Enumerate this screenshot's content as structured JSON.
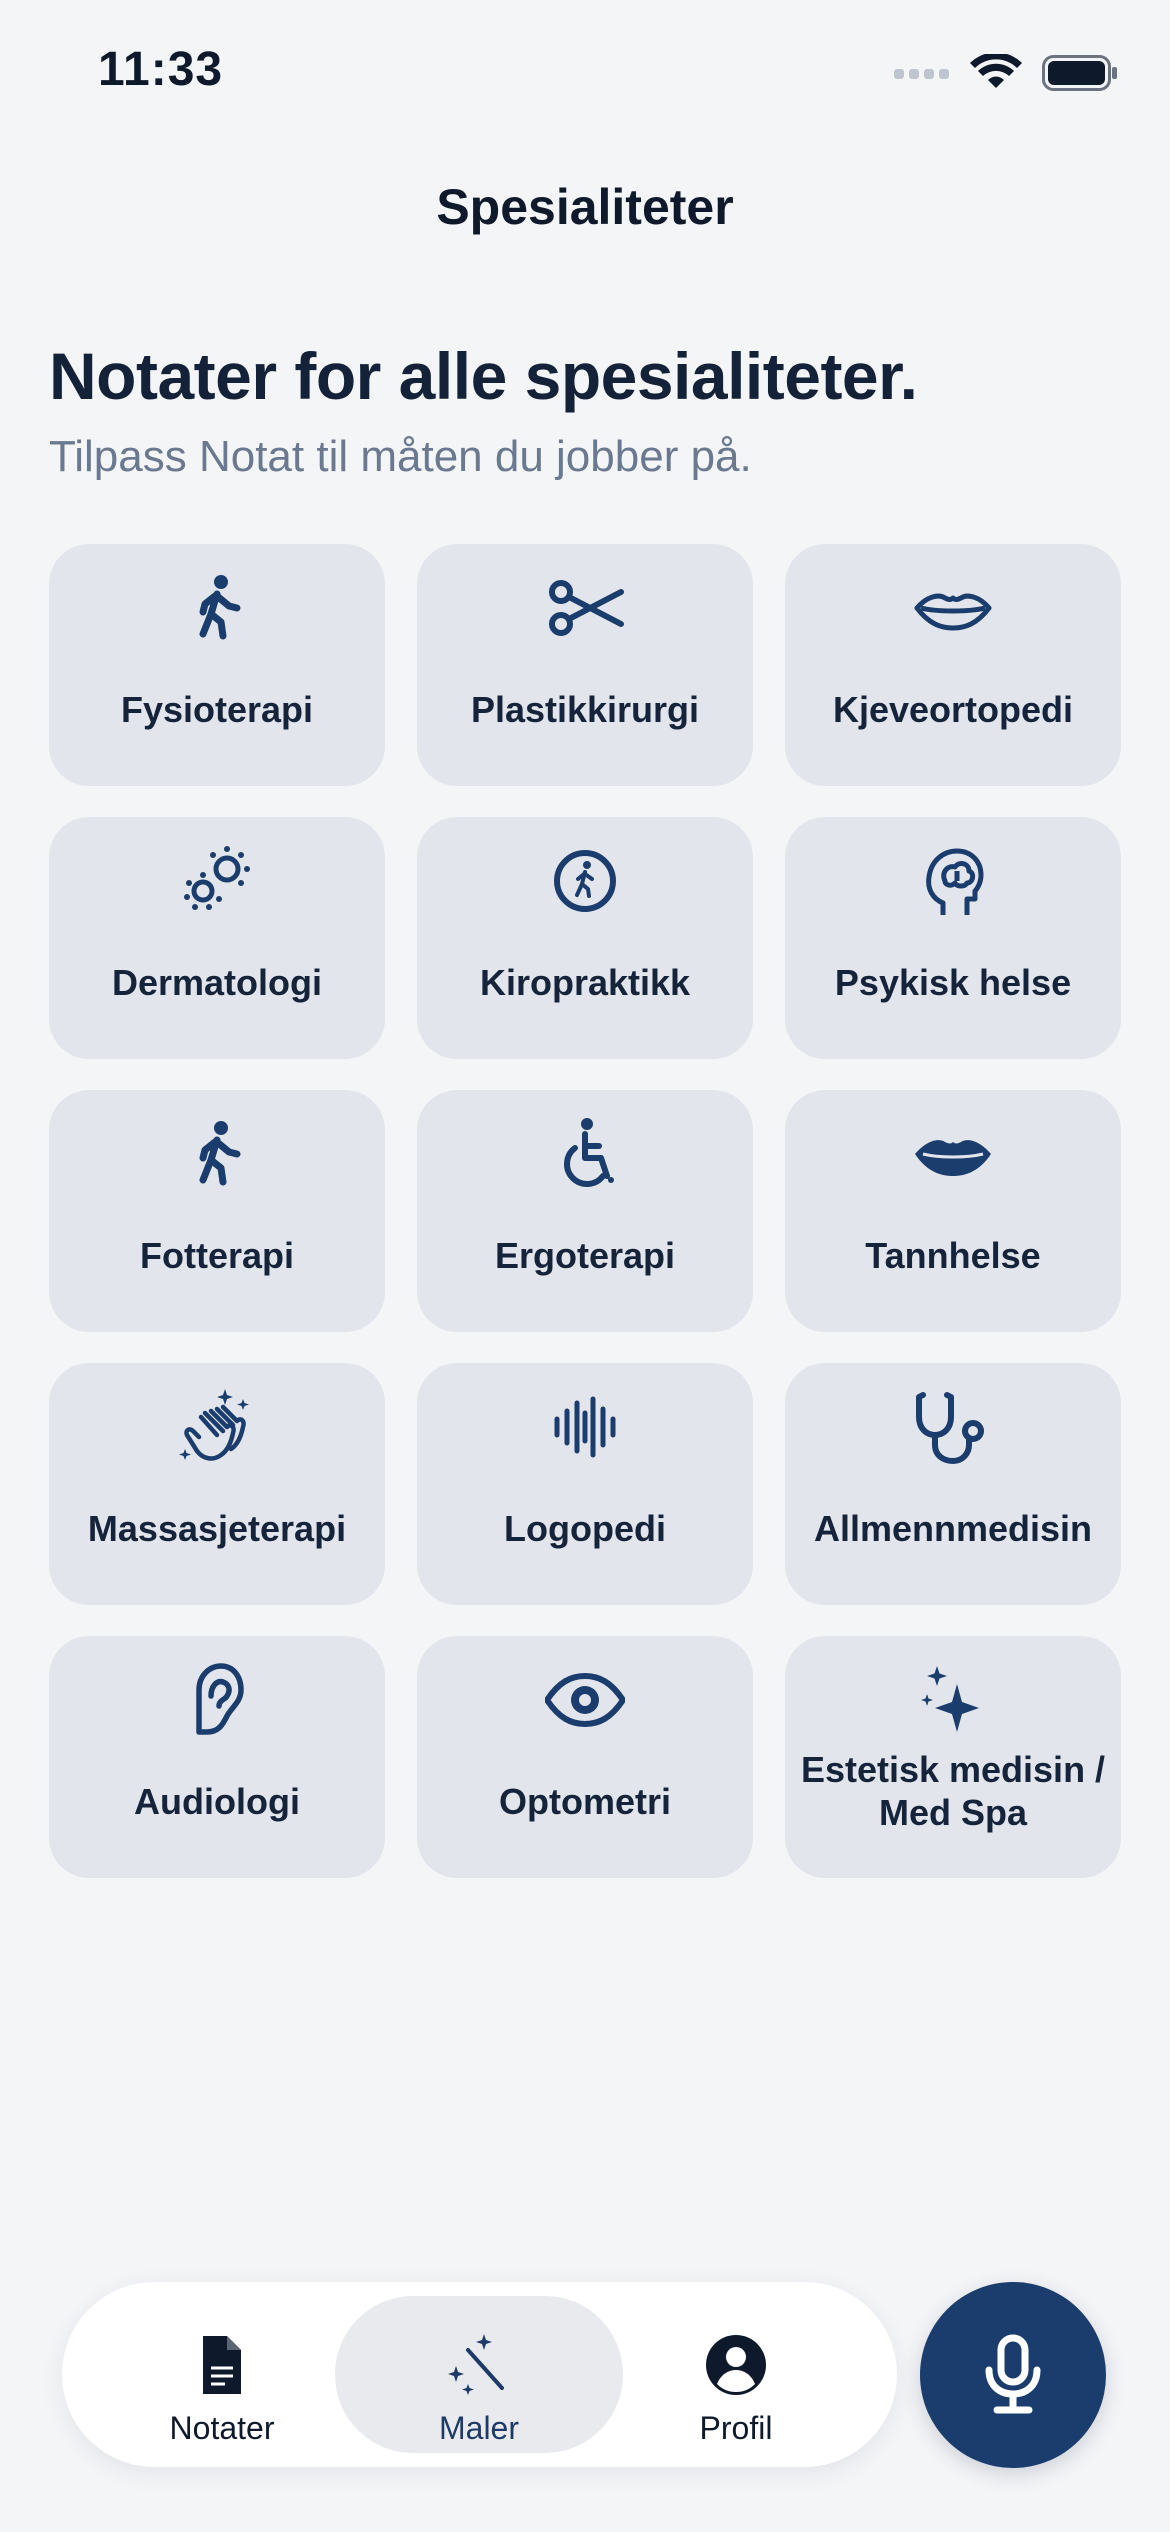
{
  "status": {
    "time": "11:33"
  },
  "nav": {
    "title": "Spesialiteter"
  },
  "header": {
    "headline": "Notater for alle spesialiteter.",
    "subheadline": "Tilpass Notat til måten du jobber på."
  },
  "specialties": [
    {
      "label": "Fysioterapi",
      "icon": "walking-person-icon"
    },
    {
      "label": "Plastikkirurgi",
      "icon": "scissors-icon"
    },
    {
      "label": "Kjeveortopedi",
      "icon": "mouth-outline-icon"
    },
    {
      "label": "Dermatologi",
      "icon": "cells-icon"
    },
    {
      "label": "Kiropraktikk",
      "icon": "walking-circle-icon"
    },
    {
      "label": "Psykisk helse",
      "icon": "brain-head-icon"
    },
    {
      "label": "Fotterapi",
      "icon": "walking-person-icon"
    },
    {
      "label": "Ergoterapi",
      "icon": "wheelchair-icon"
    },
    {
      "label": "Tannhelse",
      "icon": "mouth-filled-icon"
    },
    {
      "label": "Massasjeterapi",
      "icon": "clapping-hands-icon"
    },
    {
      "label": "Logopedi",
      "icon": "waveform-icon"
    },
    {
      "label": "Allmennmedisin",
      "icon": "stethoscope-icon"
    },
    {
      "label": "Audiologi",
      "icon": "ear-icon"
    },
    {
      "label": "Optometri",
      "icon": "eye-icon"
    },
    {
      "label": "Estetisk medisin / Med Spa",
      "icon": "sparkles-icon"
    }
  ],
  "tabbar": {
    "tabs": [
      {
        "label": "Notater",
        "icon": "document-icon",
        "active": false
      },
      {
        "label": "Maler",
        "icon": "magic-wand-icon",
        "active": true
      },
      {
        "label": "Profil",
        "icon": "profile-icon",
        "active": false
      }
    ]
  },
  "mic": {
    "icon": "microphone-icon"
  },
  "colors": {
    "background": "#F4F5F7",
    "card": "#E2E6EC",
    "accent": "#1B3D6E",
    "text": "#15243A",
    "subtext": "#6A7890"
  }
}
